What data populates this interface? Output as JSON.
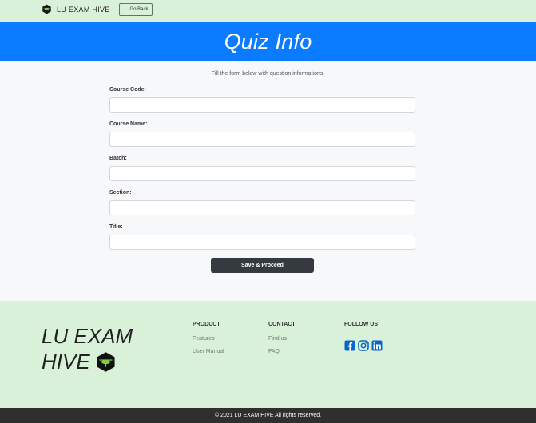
{
  "nav": {
    "brand": "LU EXAM HIVE",
    "go_back": "Go Back"
  },
  "banner": {
    "title": "Quiz Info"
  },
  "form": {
    "subtitle": "Fill the form below with question informations.",
    "fields": [
      {
        "label": "Course Code:",
        "value": ""
      },
      {
        "label": "Course Name:",
        "value": ""
      },
      {
        "label": "Batch:",
        "value": ""
      },
      {
        "label": "Section:",
        "value": ""
      },
      {
        "label": "Title:",
        "value": ""
      }
    ],
    "submit": "Save & Proceed"
  },
  "footer": {
    "brand_line1": "LU EXAM",
    "brand_line2": "HIVE",
    "product": {
      "heading": "PRODUCT",
      "links": [
        "Features",
        "User Manual"
      ]
    },
    "contact": {
      "heading": "CONTACT",
      "links": [
        "Find us",
        "FAQ"
      ]
    },
    "follow": {
      "heading": "FOLLOW US",
      "icons": [
        "facebook-icon",
        "instagram-icon",
        "linkedin-icon"
      ]
    },
    "copyright": "© 2021 LU EXAM HIVE All rights reserved."
  },
  "colors": {
    "nav_bg": "#d9f1d9",
    "banner_bg": "#0b7bff",
    "button_bg": "#343a40",
    "footer_bottom_bg": "#2f2f2f",
    "social_blue": "#0a66c2"
  }
}
